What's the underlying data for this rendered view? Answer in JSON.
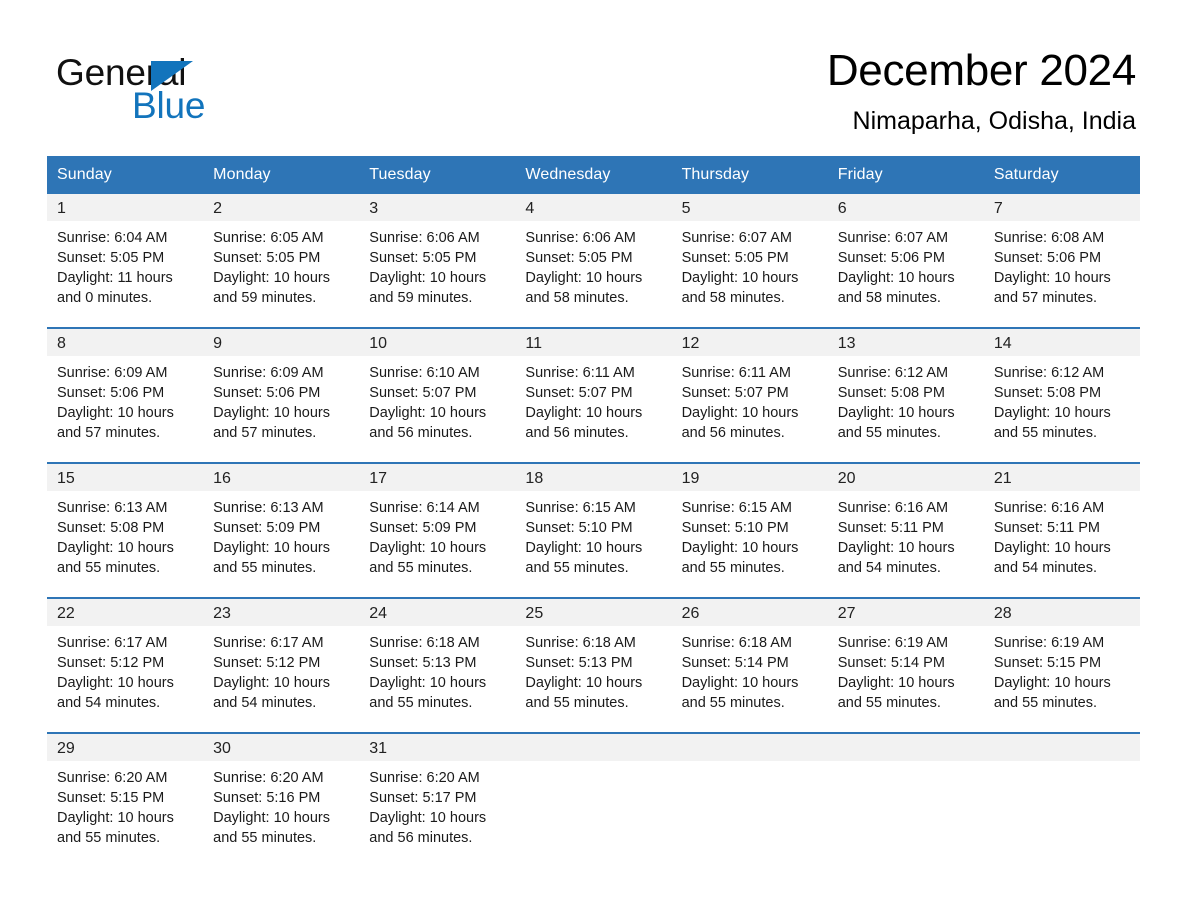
{
  "brand": {
    "name_part1": "General",
    "name_part2": "Blue",
    "triangle_icon": "brand-triangle-icon",
    "accent_color": "#1274bc"
  },
  "header": {
    "title": "December 2024",
    "subtitle": "Nimaparha, Odisha, India"
  },
  "theme": {
    "header_blue": "#2e75b6",
    "daynum_band": "#f2f2f2",
    "page_background": "#ffffff"
  },
  "calendar": {
    "weekday_headers": [
      "Sunday",
      "Monday",
      "Tuesday",
      "Wednesday",
      "Thursday",
      "Friday",
      "Saturday"
    ],
    "weeks": [
      [
        {
          "day": "1",
          "sunrise": "Sunrise: 6:04 AM",
          "sunset": "Sunset: 5:05 PM",
          "daylight_line1": "Daylight: 11 hours",
          "daylight_line2": "and 0 minutes."
        },
        {
          "day": "2",
          "sunrise": "Sunrise: 6:05 AM",
          "sunset": "Sunset: 5:05 PM",
          "daylight_line1": "Daylight: 10 hours",
          "daylight_line2": "and 59 minutes."
        },
        {
          "day": "3",
          "sunrise": "Sunrise: 6:06 AM",
          "sunset": "Sunset: 5:05 PM",
          "daylight_line1": "Daylight: 10 hours",
          "daylight_line2": "and 59 minutes."
        },
        {
          "day": "4",
          "sunrise": "Sunrise: 6:06 AM",
          "sunset": "Sunset: 5:05 PM",
          "daylight_line1": "Daylight: 10 hours",
          "daylight_line2": "and 58 minutes."
        },
        {
          "day": "5",
          "sunrise": "Sunrise: 6:07 AM",
          "sunset": "Sunset: 5:05 PM",
          "daylight_line1": "Daylight: 10 hours",
          "daylight_line2": "and 58 minutes."
        },
        {
          "day": "6",
          "sunrise": "Sunrise: 6:07 AM",
          "sunset": "Sunset: 5:06 PM",
          "daylight_line1": "Daylight: 10 hours",
          "daylight_line2": "and 58 minutes."
        },
        {
          "day": "7",
          "sunrise": "Sunrise: 6:08 AM",
          "sunset": "Sunset: 5:06 PM",
          "daylight_line1": "Daylight: 10 hours",
          "daylight_line2": "and 57 minutes."
        }
      ],
      [
        {
          "day": "8",
          "sunrise": "Sunrise: 6:09 AM",
          "sunset": "Sunset: 5:06 PM",
          "daylight_line1": "Daylight: 10 hours",
          "daylight_line2": "and 57 minutes."
        },
        {
          "day": "9",
          "sunrise": "Sunrise: 6:09 AM",
          "sunset": "Sunset: 5:06 PM",
          "daylight_line1": "Daylight: 10 hours",
          "daylight_line2": "and 57 minutes."
        },
        {
          "day": "10",
          "sunrise": "Sunrise: 6:10 AM",
          "sunset": "Sunset: 5:07 PM",
          "daylight_line1": "Daylight: 10 hours",
          "daylight_line2": "and 56 minutes."
        },
        {
          "day": "11",
          "sunrise": "Sunrise: 6:11 AM",
          "sunset": "Sunset: 5:07 PM",
          "daylight_line1": "Daylight: 10 hours",
          "daylight_line2": "and 56 minutes."
        },
        {
          "day": "12",
          "sunrise": "Sunrise: 6:11 AM",
          "sunset": "Sunset: 5:07 PM",
          "daylight_line1": "Daylight: 10 hours",
          "daylight_line2": "and 56 minutes."
        },
        {
          "day": "13",
          "sunrise": "Sunrise: 6:12 AM",
          "sunset": "Sunset: 5:08 PM",
          "daylight_line1": "Daylight: 10 hours",
          "daylight_line2": "and 55 minutes."
        },
        {
          "day": "14",
          "sunrise": "Sunrise: 6:12 AM",
          "sunset": "Sunset: 5:08 PM",
          "daylight_line1": "Daylight: 10 hours",
          "daylight_line2": "and 55 minutes."
        }
      ],
      [
        {
          "day": "15",
          "sunrise": "Sunrise: 6:13 AM",
          "sunset": "Sunset: 5:08 PM",
          "daylight_line1": "Daylight: 10 hours",
          "daylight_line2": "and 55 minutes."
        },
        {
          "day": "16",
          "sunrise": "Sunrise: 6:13 AM",
          "sunset": "Sunset: 5:09 PM",
          "daylight_line1": "Daylight: 10 hours",
          "daylight_line2": "and 55 minutes."
        },
        {
          "day": "17",
          "sunrise": "Sunrise: 6:14 AM",
          "sunset": "Sunset: 5:09 PM",
          "daylight_line1": "Daylight: 10 hours",
          "daylight_line2": "and 55 minutes."
        },
        {
          "day": "18",
          "sunrise": "Sunrise: 6:15 AM",
          "sunset": "Sunset: 5:10 PM",
          "daylight_line1": "Daylight: 10 hours",
          "daylight_line2": "and 55 minutes."
        },
        {
          "day": "19",
          "sunrise": "Sunrise: 6:15 AM",
          "sunset": "Sunset: 5:10 PM",
          "daylight_line1": "Daylight: 10 hours",
          "daylight_line2": "and 55 minutes."
        },
        {
          "day": "20",
          "sunrise": "Sunrise: 6:16 AM",
          "sunset": "Sunset: 5:11 PM",
          "daylight_line1": "Daylight: 10 hours",
          "daylight_line2": "and 54 minutes."
        },
        {
          "day": "21",
          "sunrise": "Sunrise: 6:16 AM",
          "sunset": "Sunset: 5:11 PM",
          "daylight_line1": "Daylight: 10 hours",
          "daylight_line2": "and 54 minutes."
        }
      ],
      [
        {
          "day": "22",
          "sunrise": "Sunrise: 6:17 AM",
          "sunset": "Sunset: 5:12 PM",
          "daylight_line1": "Daylight: 10 hours",
          "daylight_line2": "and 54 minutes."
        },
        {
          "day": "23",
          "sunrise": "Sunrise: 6:17 AM",
          "sunset": "Sunset: 5:12 PM",
          "daylight_line1": "Daylight: 10 hours",
          "daylight_line2": "and 54 minutes."
        },
        {
          "day": "24",
          "sunrise": "Sunrise: 6:18 AM",
          "sunset": "Sunset: 5:13 PM",
          "daylight_line1": "Daylight: 10 hours",
          "daylight_line2": "and 55 minutes."
        },
        {
          "day": "25",
          "sunrise": "Sunrise: 6:18 AM",
          "sunset": "Sunset: 5:13 PM",
          "daylight_line1": "Daylight: 10 hours",
          "daylight_line2": "and 55 minutes."
        },
        {
          "day": "26",
          "sunrise": "Sunrise: 6:18 AM",
          "sunset": "Sunset: 5:14 PM",
          "daylight_line1": "Daylight: 10 hours",
          "daylight_line2": "and 55 minutes."
        },
        {
          "day": "27",
          "sunrise": "Sunrise: 6:19 AM",
          "sunset": "Sunset: 5:14 PM",
          "daylight_line1": "Daylight: 10 hours",
          "daylight_line2": "and 55 minutes."
        },
        {
          "day": "28",
          "sunrise": "Sunrise: 6:19 AM",
          "sunset": "Sunset: 5:15 PM",
          "daylight_line1": "Daylight: 10 hours",
          "daylight_line2": "and 55 minutes."
        }
      ],
      [
        {
          "day": "29",
          "sunrise": "Sunrise: 6:20 AM",
          "sunset": "Sunset: 5:15 PM",
          "daylight_line1": "Daylight: 10 hours",
          "daylight_line2": "and 55 minutes."
        },
        {
          "day": "30",
          "sunrise": "Sunrise: 6:20 AM",
          "sunset": "Sunset: 5:16 PM",
          "daylight_line1": "Daylight: 10 hours",
          "daylight_line2": "and 55 minutes."
        },
        {
          "day": "31",
          "sunrise": "Sunrise: 6:20 AM",
          "sunset": "Sunset: 5:17 PM",
          "daylight_line1": "Daylight: 10 hours",
          "daylight_line2": "and 56 minutes."
        },
        {
          "day": "",
          "sunrise": "",
          "sunset": "",
          "daylight_line1": "",
          "daylight_line2": ""
        },
        {
          "day": "",
          "sunrise": "",
          "sunset": "",
          "daylight_line1": "",
          "daylight_line2": ""
        },
        {
          "day": "",
          "sunrise": "",
          "sunset": "",
          "daylight_line1": "",
          "daylight_line2": ""
        },
        {
          "day": "",
          "sunrise": "",
          "sunset": "",
          "daylight_line1": "",
          "daylight_line2": ""
        }
      ]
    ]
  }
}
